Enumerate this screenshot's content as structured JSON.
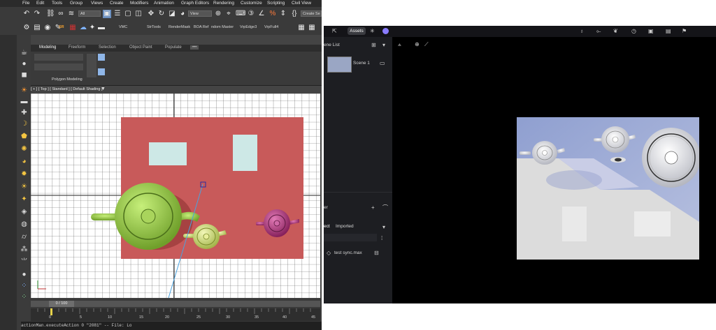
{
  "max": {
    "menu": [
      "File",
      "Edit",
      "Tools",
      "Group",
      "Views",
      "Create",
      "Modifiers",
      "Animation",
      "Graph Editors",
      "Rendering",
      "Customize",
      "Scripting",
      "Civil View"
    ],
    "toolbar1": {
      "selection_filter": "All",
      "ref_coord": "View",
      "named_set": "Create Se"
    },
    "toolbar2_labels": [
      "SR",
      "VMC",
      "StrTools",
      "RenderMask",
      "BOA Ref",
      "ndom Master",
      "VrpEdge3",
      "VrpFull4"
    ],
    "ribbon_tabs": [
      "Modeling",
      "Freeform",
      "Selection",
      "Object Paint",
      "Populate"
    ],
    "ribbon_group_label": "Polygon Modeling",
    "viewport_label": "[ + ] [ Top ] [ Standard ] [ Default Shading ]",
    "timeslider": "0 / 100",
    "ruler_ticks": [
      "0",
      "5",
      "10",
      "15",
      "20",
      "25",
      "30",
      "35",
      "40",
      "45"
    ],
    "status_line": "actionMan.executeAction 0 \"2081\" -- File: Lo"
  },
  "viewer": {
    "assets_tab": "Assets",
    "scene_list_label": "ene List",
    "scene_name": "Scene 1",
    "layer_label": "er",
    "filter_tabs": [
      "ect",
      "Imported"
    ],
    "file_name": "test sync.max"
  },
  "colors": {
    "floor": "#c85a5a",
    "teapot_green": "#8bc34a",
    "teapot_olive": "#cddc7a",
    "teapot_magenta": "#b0307a",
    "window_pane": "#cde8e6"
  }
}
